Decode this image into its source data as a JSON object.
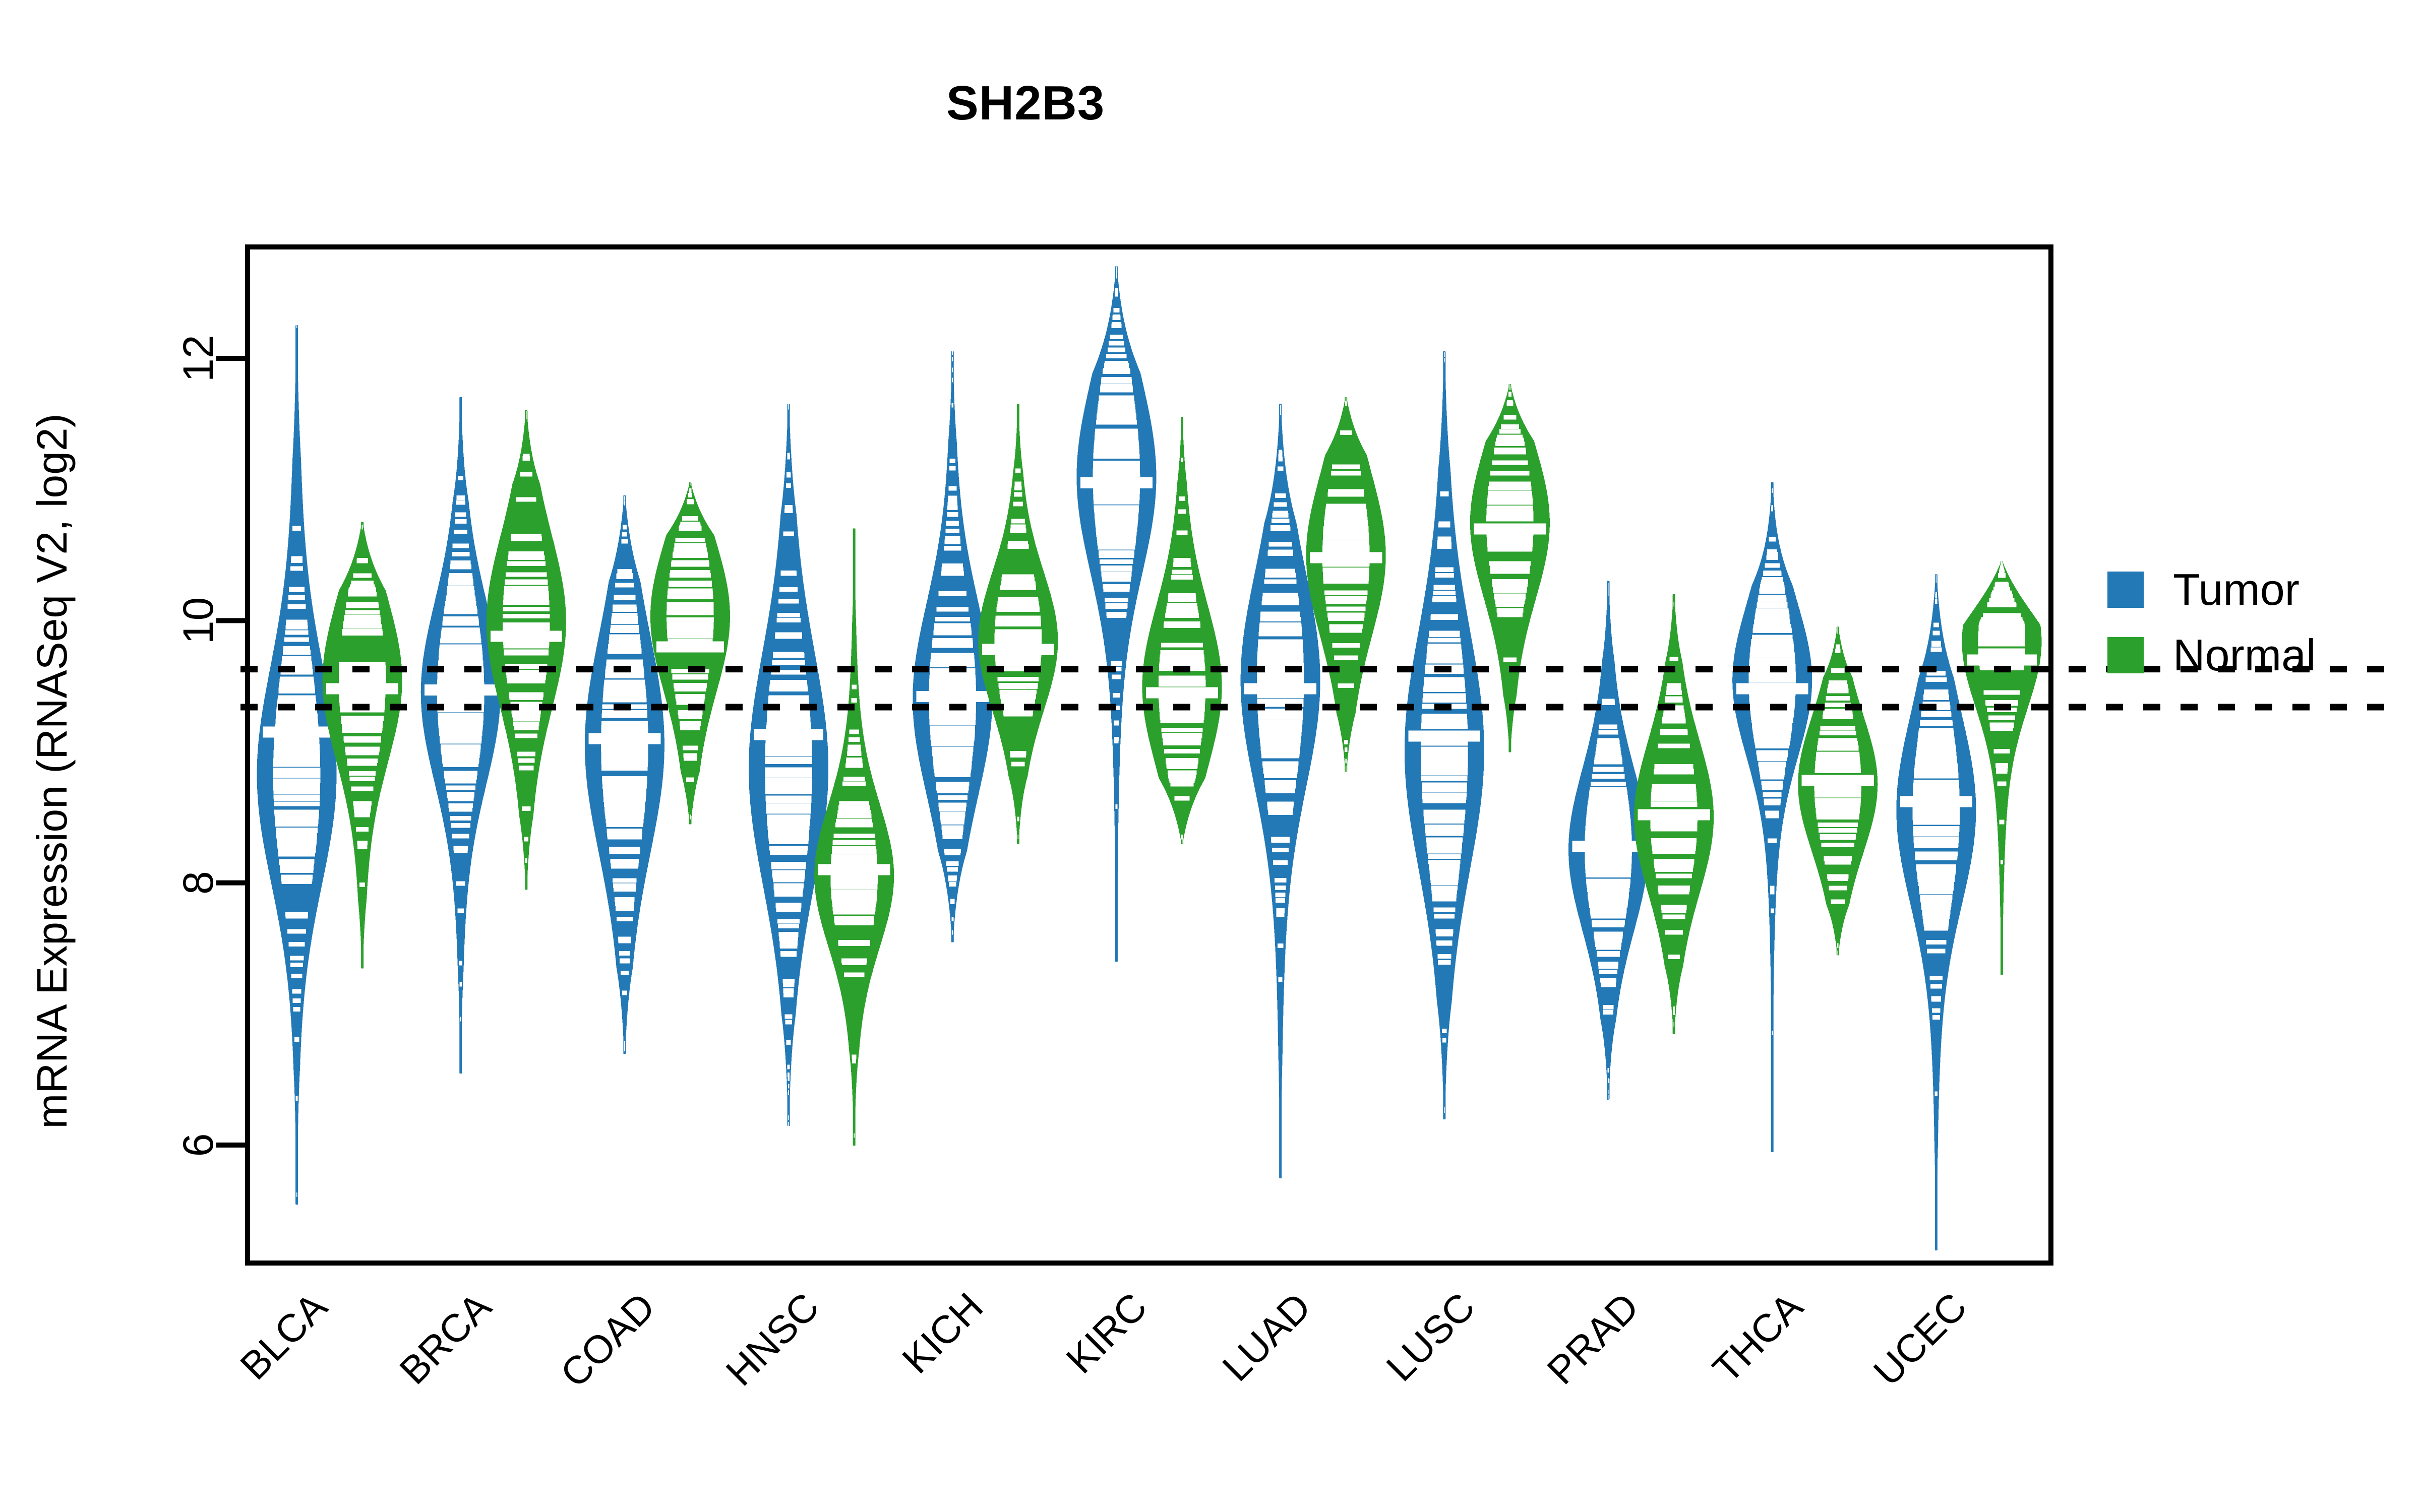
{
  "chart_data": {
    "type": "violin",
    "title": "SH2B3",
    "xlabel": "",
    "ylabel": "mRNA Expression (RNASeq V2, log2)",
    "ylim": [
      5.1,
      12.85
    ],
    "yticks": [
      6,
      8,
      10,
      12
    ],
    "ytick_labels": [
      "6",
      "8",
      "10",
      "12"
    ],
    "grid": false,
    "legend_position": "right",
    "reference_lines": [
      9.63,
      9.34
    ],
    "reference_line_style": "dotted",
    "categories": [
      "BLCA",
      "BRCA",
      "COAD",
      "HNSC",
      "KICH",
      "KIRC",
      "LUAD",
      "LUSC",
      "PRAD",
      "THCA",
      "UCEC"
    ],
    "series": [
      {
        "name": "Tumor",
        "color": "#2379B6",
        "stats": [
          {
            "category": "BLCA",
            "median": 9.15,
            "q1": 8.55,
            "q3": 9.62,
            "min": 5.55,
            "max": 12.25,
            "mode": 8.8
          },
          {
            "category": "BRCA",
            "median": 9.47,
            "q1": 9.0,
            "q3": 9.9,
            "min": 6.55,
            "max": 11.7,
            "mode": 9.45
          },
          {
            "category": "COAD",
            "median": 9.1,
            "q1": 8.55,
            "q3": 9.62,
            "min": 6.7,
            "max": 10.95,
            "mode": 9.05
          },
          {
            "category": "HNSC",
            "median": 9.13,
            "q1": 8.55,
            "q3": 9.7,
            "min": 6.15,
            "max": 11.65,
            "mode": 8.85
          },
          {
            "category": "KICH",
            "median": 9.42,
            "q1": 8.9,
            "q3": 9.85,
            "min": 7.55,
            "max": 12.05,
            "mode": 9.4
          },
          {
            "category": "KIRC",
            "median": 11.05,
            "q1": 10.55,
            "q3": 11.5,
            "min": 7.4,
            "max": 12.7,
            "mode": 11.1
          },
          {
            "category": "LUAD",
            "median": 9.48,
            "q1": 8.95,
            "q3": 10.0,
            "min": 5.75,
            "max": 11.65,
            "mode": 9.55
          },
          {
            "category": "LUSC",
            "median": 9.12,
            "q1": 8.55,
            "q3": 9.72,
            "min": 6.2,
            "max": 12.05,
            "mode": 9.0
          },
          {
            "category": "PRAD",
            "median": 8.28,
            "q1": 7.9,
            "q3": 8.7,
            "min": 6.35,
            "max": 10.3,
            "mode": 8.25
          },
          {
            "category": "THCA",
            "median": 9.48,
            "q1": 9.1,
            "q3": 9.85,
            "min": 5.95,
            "max": 11.05,
            "mode": 9.55
          },
          {
            "category": "UCEC",
            "median": 8.62,
            "q1": 8.15,
            "q3": 9.08,
            "min": 5.2,
            "max": 10.35,
            "mode": 8.55
          }
        ]
      },
      {
        "name": "Normal",
        "color": "#2CA02C",
        "stats": [
          {
            "category": "BLCA",
            "median": 9.48,
            "q1": 9.05,
            "q3": 9.85,
            "min": 7.35,
            "max": 10.75,
            "mode": 9.55
          },
          {
            "category": "BRCA",
            "median": 9.88,
            "q1": 9.45,
            "q3": 10.3,
            "min": 7.95,
            "max": 11.6,
            "mode": 10.0
          },
          {
            "category": "COAD",
            "median": 9.8,
            "q1": 9.45,
            "q3": 10.2,
            "min": 8.45,
            "max": 11.05,
            "mode": 10.05
          },
          {
            "category": "HNSC",
            "median": 8.1,
            "q1": 7.8,
            "q3": 8.5,
            "min": 6.0,
            "max": 10.7,
            "mode": 8.05
          },
          {
            "category": "KICH",
            "median": 9.78,
            "q1": 9.42,
            "q3": 10.1,
            "min": 8.3,
            "max": 11.65,
            "mode": 9.85
          },
          {
            "category": "KIRC",
            "median": 9.45,
            "q1": 9.1,
            "q3": 9.9,
            "min": 8.3,
            "max": 11.55,
            "mode": 9.5
          },
          {
            "category": "LUAD",
            "median": 10.48,
            "q1": 10.1,
            "q3": 10.9,
            "min": 8.85,
            "max": 11.7,
            "mode": 10.5
          },
          {
            "category": "LUSC",
            "median": 10.7,
            "q1": 10.3,
            "q3": 11.05,
            "min": 9.0,
            "max": 11.8,
            "mode": 10.75
          },
          {
            "category": "PRAD",
            "median": 8.52,
            "q1": 8.2,
            "q3": 8.95,
            "min": 6.85,
            "max": 10.2,
            "mode": 8.5
          },
          {
            "category": "THCA",
            "median": 8.78,
            "q1": 8.48,
            "q3": 9.15,
            "min": 7.45,
            "max": 9.95,
            "mode": 8.75
          },
          {
            "category": "UCEC",
            "median": 9.7,
            "q1": 9.35,
            "q3": 10.0,
            "min": 7.3,
            "max": 10.45,
            "mode": 9.85
          }
        ]
      }
    ]
  },
  "legend": {
    "items": [
      {
        "label": "Tumor",
        "color": "#2379B6"
      },
      {
        "label": "Normal",
        "color": "#2CA02C"
      }
    ]
  },
  "axes": {
    "y_axis_title": "mRNA Expression (RNASeq V2, log2)"
  }
}
